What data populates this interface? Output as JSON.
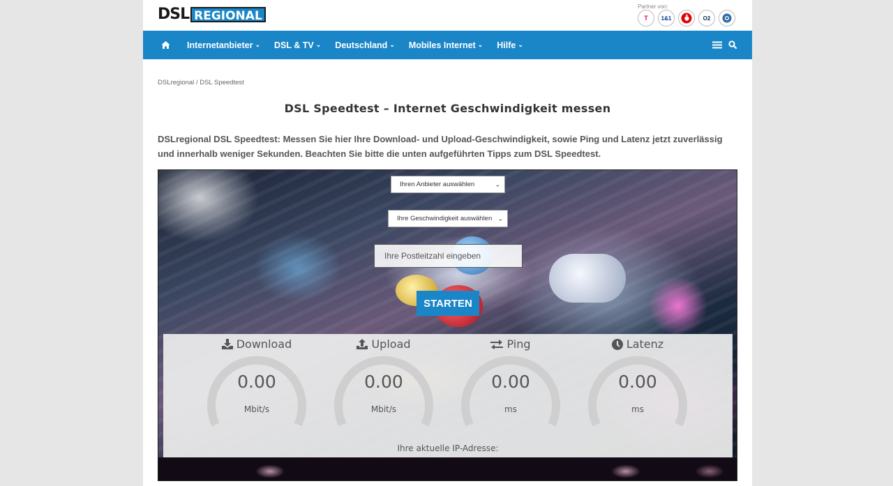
{
  "logo": {
    "part1": "DSL",
    "part2": "REGIONAL"
  },
  "partners": {
    "label": "Partner von:",
    "items": [
      "T",
      "1&1",
      "vodafone",
      "O2",
      "congstar"
    ]
  },
  "nav": {
    "items": [
      {
        "label": "Internetanbieter"
      },
      {
        "label": "DSL & TV"
      },
      {
        "label": "Deutschland"
      },
      {
        "label": "Mobiles Internet"
      },
      {
        "label": "Hilfe"
      }
    ],
    "chevron": "⌄"
  },
  "breadcrumb": {
    "home": "DSLregional",
    "sep": "/",
    "current": "DSL Speedtest"
  },
  "title": "DSL Speedtest – Internet Geschwindigkeit messen",
  "intro": "DSLregional DSL Speedtest: Messen Sie hier Ihre Download- und Upload-Geschwindigkeit, sowie Ping und Latenz jetzt zuverlässig und innerhalb weniger Sekunden. Beachten Sie bitte die unten aufgeführten Tipps zum DSL Speedtest.",
  "speedtest": {
    "provider_select": "Ihren Anbieter auswählen",
    "speed_select": "Ihre Geschwindigkeit auswählen",
    "plz_placeholder": "Ihre Postleitzahl eingeben",
    "start_label": "STARTEN",
    "ip_label": "Ihre aktuelle IP-Adresse:",
    "gauges": [
      {
        "label": "Download",
        "value": "0.00",
        "unit": "Mbit/s",
        "icon": "download-icon"
      },
      {
        "label": "Upload",
        "value": "0.00",
        "unit": "Mbit/s",
        "icon": "upload-icon"
      },
      {
        "label": "Ping",
        "value": "0.00",
        "unit": "ms",
        "icon": "exchange-icon"
      },
      {
        "label": "Latenz",
        "value": "0.00",
        "unit": "ms",
        "icon": "clock-icon"
      }
    ]
  },
  "colors": {
    "brand": "#1a86c8",
    "gauge_track": "#cfcfcf"
  }
}
